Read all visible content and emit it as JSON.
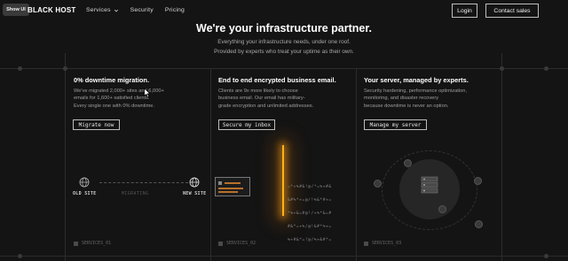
{
  "header": {
    "show_ui": "Show UI",
    "brand": "BLACK HOST",
    "nav": [
      "Services",
      "Security",
      "Pricing"
    ],
    "login": "Login",
    "contact": "Contact sales"
  },
  "hero": {
    "title": "We're your infrastructure partner.",
    "sub1": "Everything your infrastructure needs, under one roof.",
    "sub2": "Provided by experts who treat your uptime as their own."
  },
  "cards": [
    {
      "title": "0% downtime migration.",
      "body": [
        "We've migrated 2,000+ sites and 6,000+",
        "emails for 1,600+ satisfied clients.",
        "Every single one with 0% downtime."
      ],
      "button": "Migrate now",
      "old_site": "OLD SITE",
      "new_site": "NEW SITE",
      "migrating": "MIGRATING",
      "tag": "SERVICES_01"
    },
    {
      "title": "End to end encrypted business email.",
      "body": [
        "Clients are 9x more likely to choose",
        "business email. Our email has military-",
        "grade encryption and unlimited addresses."
      ],
      "button": "Secure my inbox",
      "cipher": [
        "=*+%#&!@/*=%+#&",
        "&#%*+=@/!%&*#+=",
        "*%+&=#@!/+%*&=#",
        "#&*=+%/@!&#*%+=",
        "%+#&*=!@/%+&#*="
      ],
      "tag": "SERVICES_02"
    },
    {
      "title": "Your server, managed by experts.",
      "body": [
        "Security hardening, performance optimization,",
        "monitoring, and disaster recovery",
        "because downtime is never an option."
      ],
      "button": "Manage my server",
      "tag": "SERVICES_03"
    }
  ],
  "colors": {
    "background": "#141414",
    "accent_beam": "#ffb21a",
    "border": "#bdbdbd"
  },
  "icons": {
    "cursor": "arrow-pointer-icon",
    "globe": "globe-icon",
    "user": "user-icon",
    "server": "server-rack-icon"
  }
}
